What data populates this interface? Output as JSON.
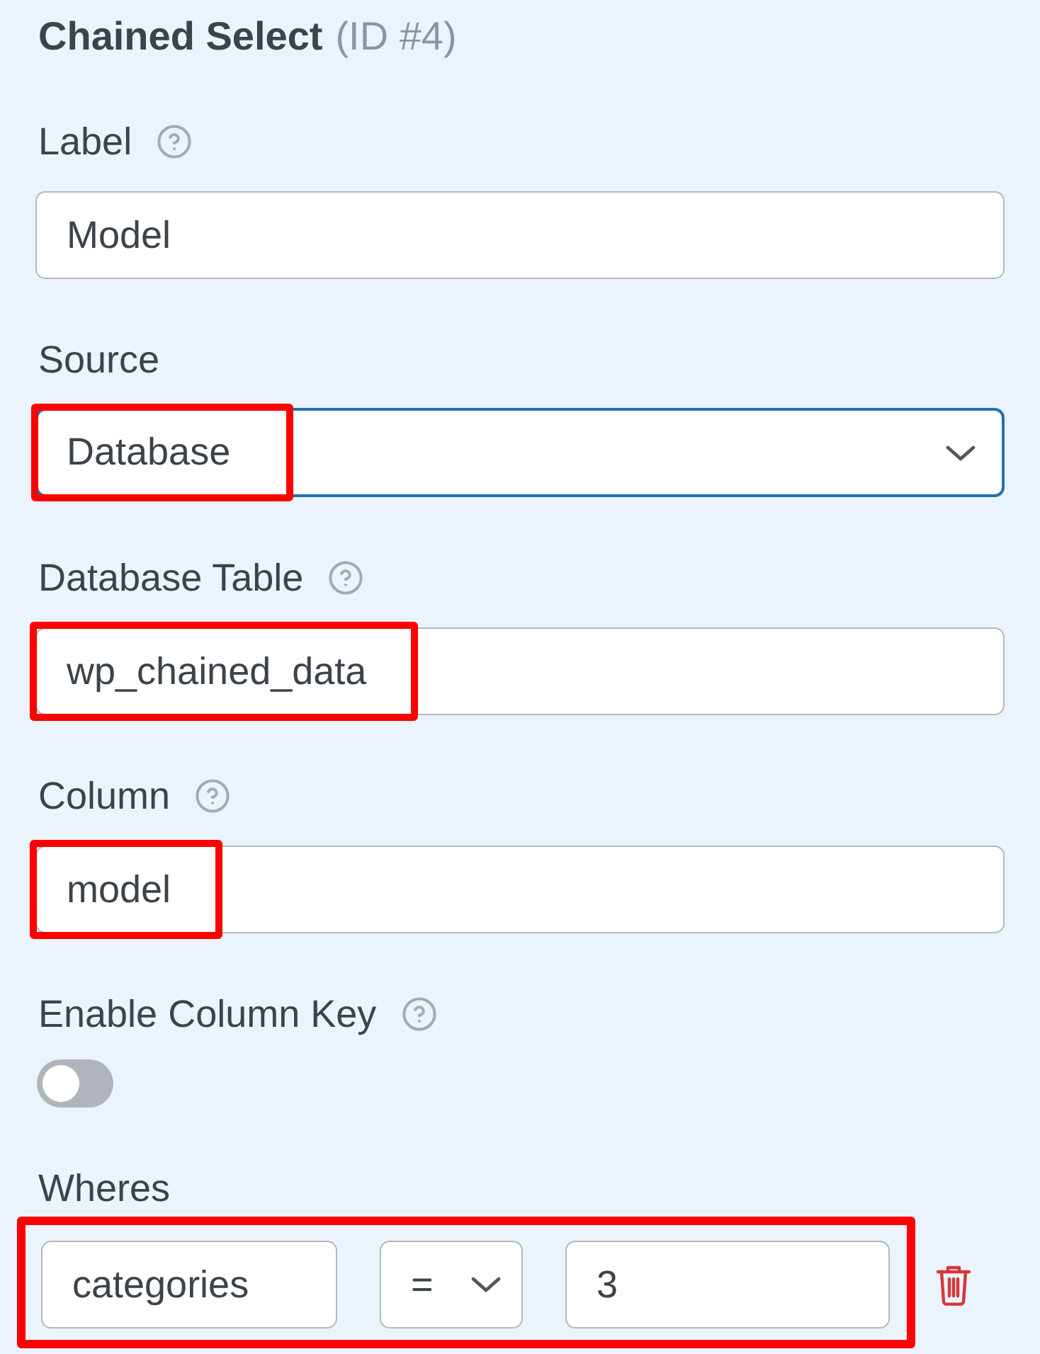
{
  "panel": {
    "title": "Chained Select",
    "id": "(ID #4)"
  },
  "fields": [
    {
      "kind": "text",
      "label": "Label",
      "help": true,
      "value": "Model",
      "focused": false,
      "highlighted": false
    },
    {
      "kind": "select",
      "label": "Source",
      "help": false,
      "value": "Database",
      "focused": true,
      "highlighted": true
    },
    {
      "kind": "text",
      "label": "Database Table",
      "help": true,
      "value": "wp_chained_data",
      "focused": false,
      "highlighted": true
    },
    {
      "kind": "text",
      "label": "Column",
      "help": true,
      "value": "model",
      "focused": false,
      "highlighted": true
    },
    {
      "kind": "toggle",
      "label": "Enable Column Key",
      "help": true,
      "on": false
    },
    {
      "kind": "conditions",
      "label": "Wheres",
      "help": false,
      "highlighted": true,
      "rows": [
        {
          "column": "categories",
          "operator": "=",
          "value": "3"
        }
      ]
    }
  ]
}
